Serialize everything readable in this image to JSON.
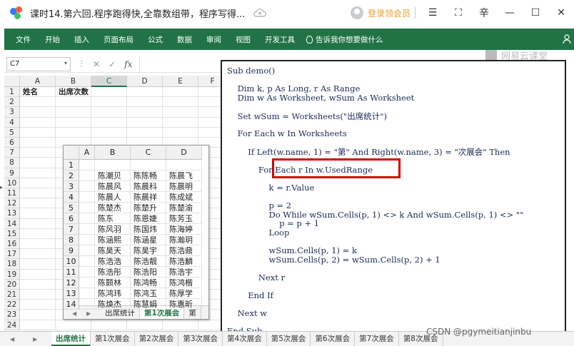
{
  "titlebar": {
    "title": "课时14.第六回.程序跑得快,全靠数组带，程序写得...",
    "vip_label": "登录领会员",
    "buttons": [
      "☰",
      "⛶",
      "⾟",
      "—",
      "☐",
      "✕"
    ]
  },
  "ribbon": {
    "tabs": [
      "文件",
      "开始",
      "插入",
      "页面布局",
      "公式",
      "数据",
      "审阅",
      "视图",
      "开发工具"
    ],
    "tell_me": "告诉我你想要做什么"
  },
  "formula_bar": {
    "name_box": "C7",
    "fx": "fx",
    "cancel": "✕",
    "enter": "✓"
  },
  "grid": {
    "columns": [
      "A",
      "B",
      "C",
      "D",
      "E",
      "F"
    ],
    "selected_column": "C",
    "rows": [
      "1",
      "2",
      "3",
      "4",
      "5",
      "6",
      "7",
      "8",
      "9",
      "10",
      "11",
      "12",
      "13",
      "14",
      "15",
      "16",
      "17",
      "18",
      "19",
      "20",
      "21",
      "22",
      "23",
      "24"
    ],
    "cells": {
      "A1": "姓名",
      "B1": "出席次数"
    }
  },
  "inner_sheet": {
    "columns": [
      "A",
      "B",
      "C",
      "D"
    ],
    "rows": [
      "1",
      "2",
      "3",
      "4",
      "5",
      "6",
      "7",
      "8",
      "9",
      "10",
      "11",
      "12",
      "13",
      "14"
    ],
    "data": [
      [
        "",
        "",
        ""
      ],
      [
        "陈潮贝",
        "陈陈畅",
        "陈晨飞"
      ],
      [
        "陈晨风",
        "陈晨科",
        "陈晨明"
      ],
      [
        "陈晨人",
        "陈晨祥",
        "陈成斌"
      ],
      [
        "陈楚杰",
        "陈楚升",
        "陈楚渝"
      ],
      [
        "陈东",
        "陈恩婕",
        "陈芳玉"
      ],
      [
        "陈风羽",
        "陈国炜",
        "陈海婷"
      ],
      [
        "陈涵熙",
        "陈涵星",
        "陈瀚玥"
      ],
      [
        "陈昊天",
        "陈昊宇",
        "陈浩鼎"
      ],
      [
        "陈浩浩",
        "陈浩靓",
        "陈浩麟"
      ],
      [
        "陈浩彤",
        "陈浩阳",
        "陈浩宇"
      ],
      [
        "陈颢林",
        "陈鸿畅",
        "陈鸿楷"
      ],
      [
        "陈鸿玮",
        "陈鸿玉",
        "陈厚学"
      ],
      [
        "陈焕杰",
        "陈慧娟",
        "陈惠昕"
      ]
    ],
    "tabs": [
      "出席统计",
      "第1次展会",
      "第"
    ],
    "active_tab": "第1次展会"
  },
  "code": {
    "lines": [
      "Sub demo()",
      "",
      "    Dim k, p As Long, r As Range",
      "    Dim w As Worksheet, wSum As Worksheet",
      "",
      "    Set wSum = Worksheets(\"出席统计\")",
      "",
      "    For Each w In Worksheets",
      "",
      "        If Left(w.name, 1) = \"第\" And Right(w.name, 3) = \"次展会\" Then",
      "",
      "            For Each r In w.UsedRange",
      "",
      "                k = r.Value",
      "",
      "                p = 2",
      "                Do While wSum.Cells(p, 1) <> k And wSum.Cells(p, 1) <> \"\"",
      "                    p = p + 1",
      "                Loop",
      "",
      "                wSum.Cells(p, 1) = k",
      "                wSum.Cells(p, 2) = wSum.Cells(p, 2) + 1",
      "",
      "            Next r",
      "",
      "        End If",
      "",
      "    Next w",
      "",
      "End Sub"
    ]
  },
  "watermark": "网易云课堂",
  "tabbar": {
    "tabs": [
      "出席统计",
      "第1次展会",
      "第2次展会",
      "第3次展会",
      "第4次展会",
      "第5次展会",
      "第6次展会",
      "第7次展会",
      "第8次展会"
    ],
    "active_tab": "出席统计"
  },
  "csdn_watermark": "CSDN @pgymeitianjinbu"
}
